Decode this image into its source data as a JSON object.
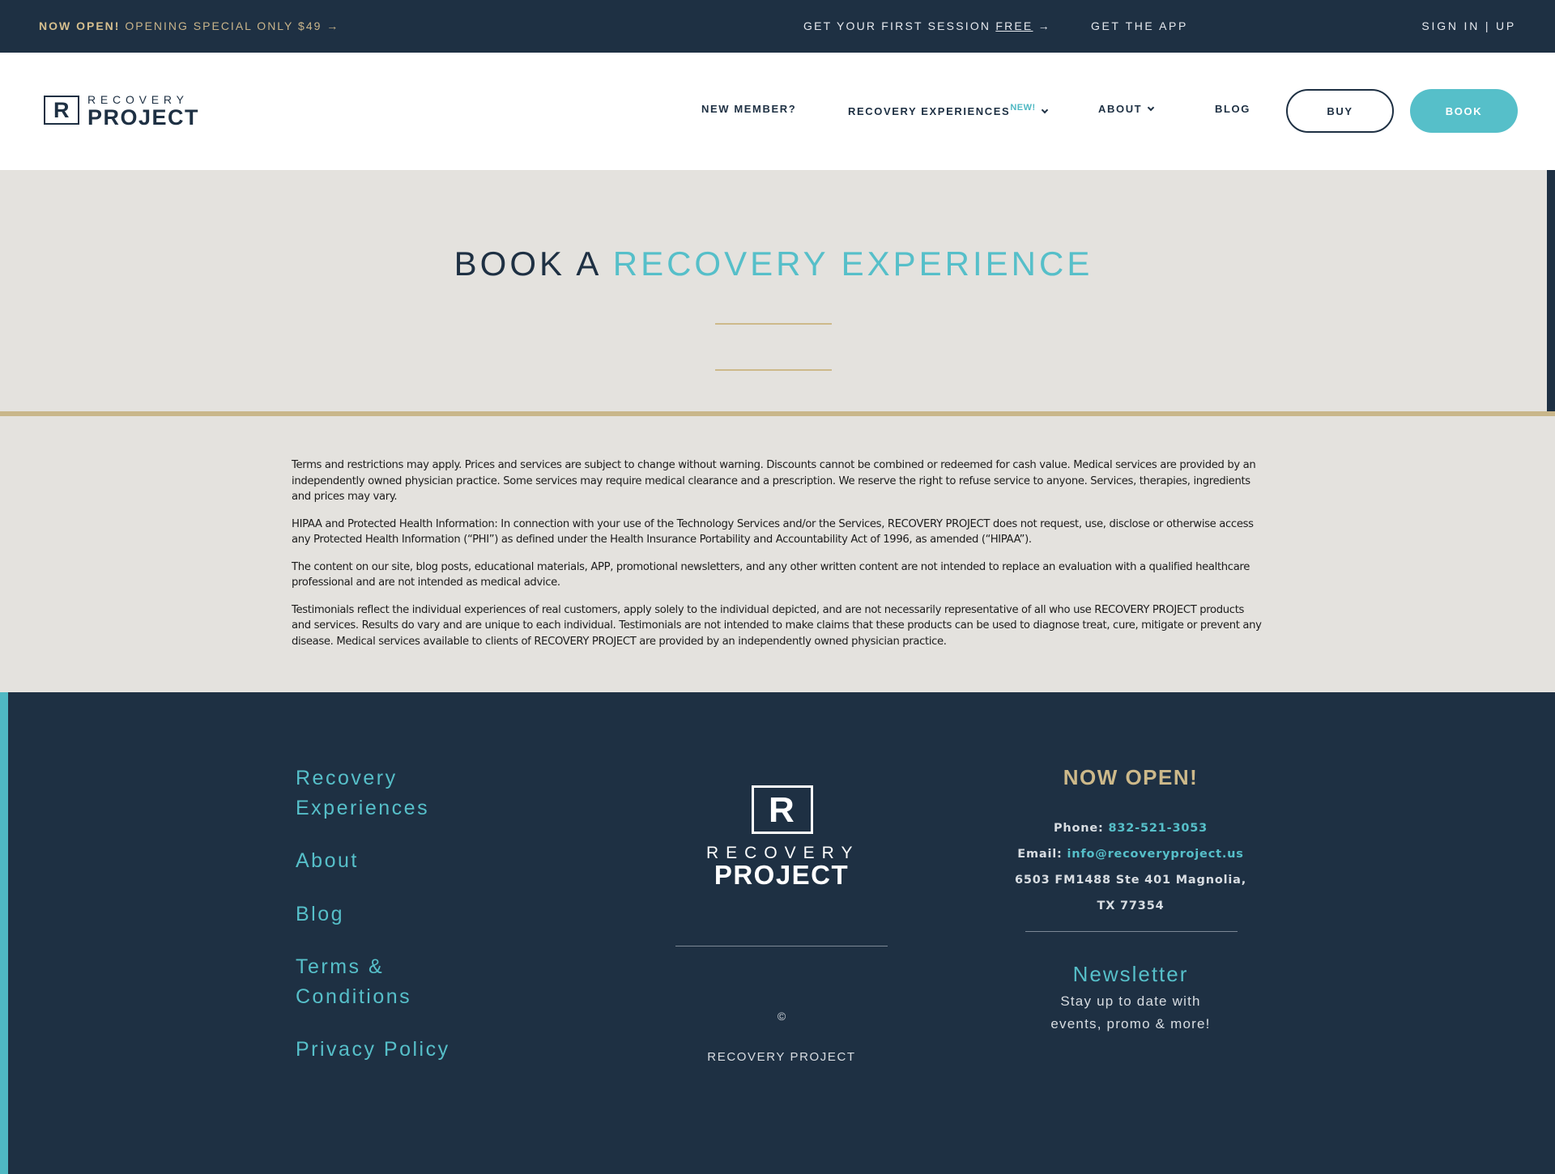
{
  "topbar": {
    "promo_bold": "NOW OPEN!",
    "promo_rest": "OPENING SPECIAL ONLY $49 →",
    "first_session_pre": "GET YOUR FIRST SESSION",
    "first_session_link": "FREE",
    "first_session_arrow": "→",
    "get_app": "GET THE APP",
    "sign_in": "SIGN IN | UP"
  },
  "header": {
    "logo_line1": "RECOVERY",
    "logo_line2": "PROJECT",
    "logo_mark": "R",
    "nav": {
      "new_member": "NEW MEMBER?",
      "recovery_experiences": "RECOVERY EXPERIENCES",
      "new_badge": "NEW!",
      "about": "ABOUT",
      "blog": "BLOG"
    },
    "buy_label": "BUY",
    "book_label": "BOOK"
  },
  "hero": {
    "title_plain": "BOOK A",
    "title_accent": "RECOVERY EXPERIENCE"
  },
  "disclaimer": {
    "paragraphs": [
      "Terms and restrictions may apply. Prices and services are subject to change without warning. Discounts cannot be combined or redeemed for cash value. Medical services are provided by an independently owned physician practice. Some services may require medical clearance and a prescription. We reserve the right to refuse service to anyone. Services, therapies, ingredients and prices may vary.",
      "HIPAA and Protected Health Information: In connection with your use of the Technology Services and/or the Services, RECOVERY PROJECT does not request, use, disclose or otherwise access any Protected Health Information (“PHI”) as defined under the Health Insurance Portability and Accountability Act of 1996, as amended (“HIPAA”).",
      "The content on our site, blog posts, educational materials, APP, promotional newsletters, and any other written content are not intended to replace an evaluation with a qualified healthcare professional and are not intended as medical advice.",
      "Testimonials reflect the individual experiences of real customers, apply solely to the individual depicted, and are not necessarily representative of all who use RECOVERY PROJECT products and services. Results do vary and are unique to each individual. Testimonials are not intended to make claims that these products can be used to diagnose treat, cure, mitigate or prevent any disease. Medical services available to clients of RECOVERY PROJECT are provided by an independently owned physician practice."
    ]
  },
  "footer": {
    "links": {
      "recovery_1": "Recovery",
      "recovery_2": "Experiences",
      "about": "About",
      "blog": "Blog",
      "terms_1": "Terms &",
      "terms_2": "Conditions",
      "privacy": "Privacy Policy"
    },
    "logo_mark": "R",
    "logo_line1": "RECOVERY",
    "logo_line2": "PROJECT",
    "copyright": "©",
    "company": "RECOVERY PROJECT",
    "now_open": "NOW OPEN!",
    "phone_label": "Phone:",
    "phone": "832-521-3053",
    "email_label": "Email:",
    "email": "info@recoveryproject.us",
    "address_1": "6503 FM1488 Ste 401 Magnolia,",
    "address_2": "TX 77354",
    "newsletter": "Newsletter",
    "newsletter_sub_1": "Stay up to date with",
    "newsletter_sub_2": "events, promo & more!"
  },
  "colors": {
    "navy": "#1e3043",
    "teal": "#56bfc9",
    "gold": "#cdb98a",
    "hero_bg": "#e4e2de"
  }
}
